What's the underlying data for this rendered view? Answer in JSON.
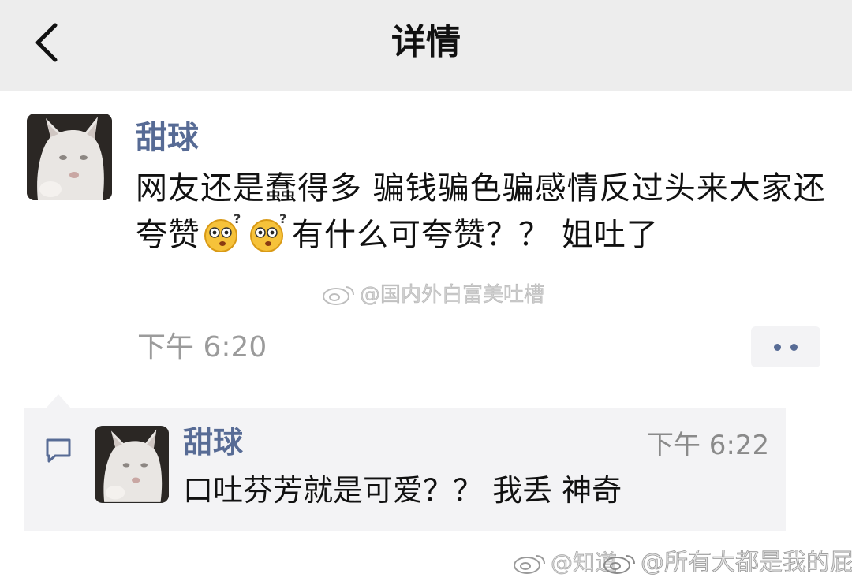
{
  "header": {
    "title": "详情",
    "back_icon": "chevron-left-icon"
  },
  "post": {
    "author": "甜球",
    "text_part1": "网友还是蠢得多 骗钱骗色骗感情反过头来大家还夸赞",
    "emojis": [
      "surprised-emoji",
      "surprised-emoji"
    ],
    "text_part2": "有什么可夸赞？？ 姐吐了",
    "time": "下午 6:20",
    "more_icon": "more-dots-icon"
  },
  "comment": {
    "icon": "comment-icon",
    "author": "甜球",
    "time": "下午 6:22",
    "text": "口吐芬芳就是可爱？？ 我丢 神奇"
  },
  "watermarks": {
    "center": "@国内外白富美吐槽",
    "bottom_left": "@知道",
    "bottom_right": "@所有大都是我的屁"
  },
  "colors": {
    "link_blue": "#576b95",
    "topbar_bg": "#ededed",
    "comment_bg": "#f3f3f5",
    "time_gray": "#9b9b9b"
  }
}
